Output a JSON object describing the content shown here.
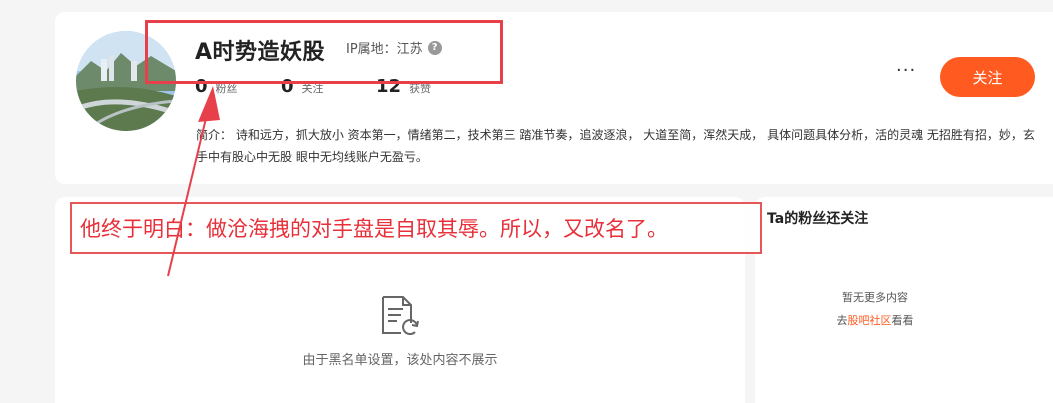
{
  "profile": {
    "username": "A时势造妖股",
    "ip_label": "IP属地：江苏",
    "stats": [
      {
        "num": "0",
        "label": "粉丝"
      },
      {
        "num": "0",
        "label": "关注"
      },
      {
        "num": "12",
        "label": "获赞"
      }
    ],
    "more_label": "···",
    "follow_label": "关注",
    "bio": "简介： 诗和远方，抓大放小 资本第一，情绪第二，技术第三 踏准节奏，追波逐浪， 大道至简，浑然天成， 具体问题具体分析，活的灵魂 无招胜有招，妙，玄 手中有股心中无股 眼中无均线账户无盈亏。"
  },
  "left_panel": {
    "blacklist_message": "由于黑名单设置，该处内容不展示",
    "icon": "document-refresh-icon"
  },
  "right_panel": {
    "title": "Ta的粉丝还关注",
    "empty_message": "暂无更多内容",
    "community_prefix": "去",
    "community_link": "股吧社区",
    "community_suffix": "看看"
  },
  "annotation": {
    "text": "他终于明白：做沧海拽的对手盘是自取其辱。所以，又改名了。",
    "color": "#e8303a"
  },
  "colors": {
    "accent": "#ff5a1f",
    "annotation_red": "#e8404a"
  }
}
